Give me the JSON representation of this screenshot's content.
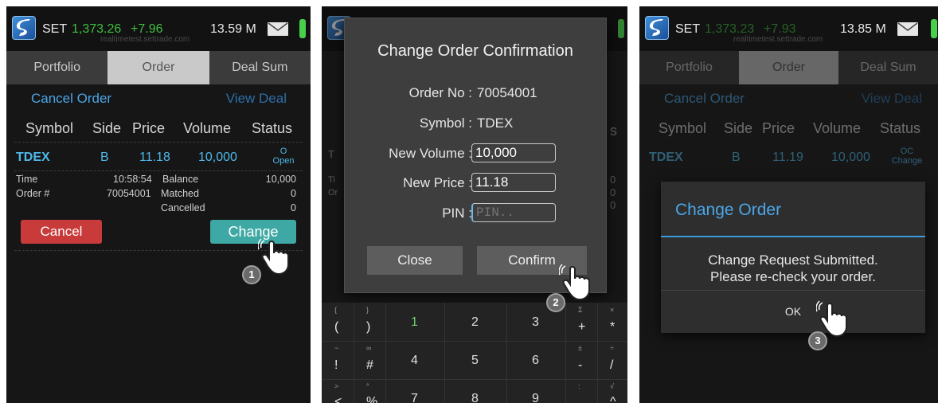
{
  "status": {
    "set_label": "SET",
    "watermark": "realtimetest.settrade.com",
    "icons": [
      "app-logo-icon",
      "mail-icon",
      "battery-icon"
    ],
    "screens": [
      {
        "index": "1,373.26",
        "change": "+7.96",
        "value": "13.59 M"
      },
      {
        "index": "1,373.23",
        "change": "+7.93",
        "value": "13.85 M"
      }
    ]
  },
  "tabs": [
    "Portfolio",
    "Order",
    "Deal Sum"
  ],
  "links": {
    "cancel_order": "Cancel Order",
    "view_deal": "View Deal"
  },
  "table": {
    "headers": [
      "Symbol",
      "Side",
      "Price",
      "Volume",
      "Status"
    ],
    "row1": {
      "symbol": "TDEX",
      "side": "B",
      "price": "11.18",
      "volume": "10,000",
      "status_code": "O",
      "status_text": "Open"
    },
    "row3": {
      "symbol": "TDEX",
      "side": "B",
      "price": "11.19",
      "volume": "10,000",
      "status_code": "OC",
      "status_text": "Change"
    }
  },
  "details": {
    "time_label": "Time",
    "time_value": "10:58:54",
    "order_label": "Order #",
    "order_value": "70054001",
    "balance_label": "Balance",
    "balance_value": "10,000",
    "matched_label": "Matched",
    "matched_value": "0",
    "cancelled_label": "Cancelled",
    "cancelled_value": "0"
  },
  "buttons": {
    "cancel": "Cancel",
    "change": "Change"
  },
  "steps": [
    "1",
    "2",
    "3"
  ],
  "confirm_dialog": {
    "title": "Change Order Confirmation",
    "order_no_label": "Order No :",
    "order_no_value": "70054001",
    "symbol_label": "Symbol :",
    "symbol_value": "TDEX",
    "new_volume_label": "New Volume :",
    "new_volume_value": "10,000",
    "new_price_label": "New Price :",
    "new_price_value": "11.18",
    "pin_label": "PIN :",
    "pin_placeholder": "PIN..",
    "close": "Close",
    "confirm": "Confirm"
  },
  "behind": {
    "t_char": "T",
    "s_char": "s",
    "zero": "0",
    "ti": "Ti",
    "or": "Or"
  },
  "keypad": {
    "row1": {
      "sym_top": "{",
      "sym": "(",
      "sym2_top": "}",
      "sym2": ")",
      "n1": "1",
      "n2": "2",
      "n3": "3",
      "op_top": "Σ",
      "op": "+",
      "op2_top": "×",
      "op2": "*"
    },
    "row2": {
      "sym_top": "~",
      "sym": "!",
      "sym2_top": "∞",
      "sym2": "#",
      "n1": "4",
      "n2": "5",
      "n3": "6",
      "op_top": "±",
      "op": "-",
      "op2_top": "÷",
      "op2": "/"
    },
    "row3": {
      "sym_top": ">",
      "sym": "<",
      "sym2_top": "°",
      "sym2": "%",
      "n1": "7",
      "n2": "8",
      "n3": "9",
      "op_top": ":",
      "op": ".",
      "op2_top": "√",
      "op2": "^"
    }
  },
  "result_dialog": {
    "title": "Change Order",
    "message_line1": "Change Request Submitted.",
    "message_line2": "Please re-check your order.",
    "ok": "OK"
  },
  "colors": {
    "accent": "#4aa6e8",
    "green": "#3fbf3f",
    "cancel_red": "#c93a3a",
    "change_teal": "#3ea9a4"
  }
}
